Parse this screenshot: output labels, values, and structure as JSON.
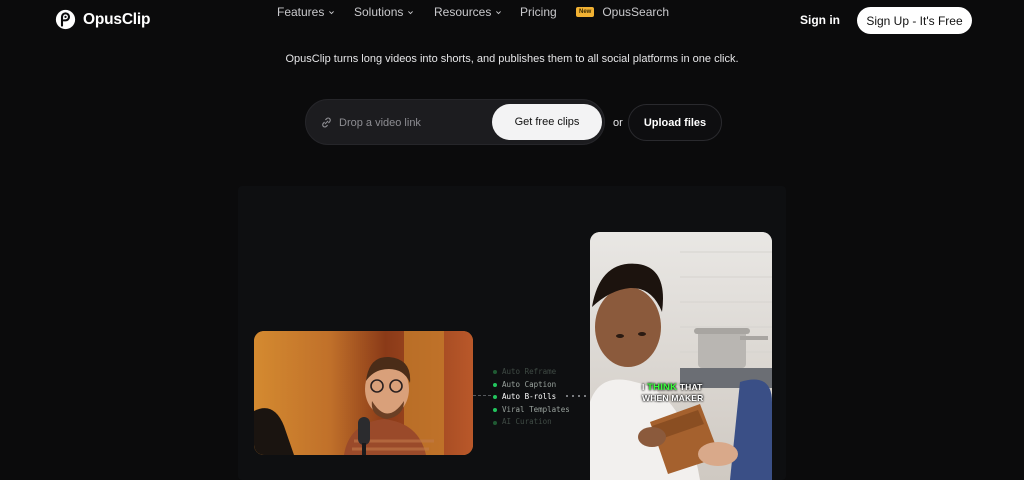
{
  "brand": {
    "name": "OpusClip"
  },
  "nav": {
    "features": "Features",
    "solutions": "Solutions",
    "resources": "Resources",
    "pricing": "Pricing",
    "new_badge": "New",
    "opussearch": "OpusSearch",
    "signin": "Sign in",
    "signup": "Sign Up - It's Free"
  },
  "hero": {
    "tagline": "OpusClip turns long videos into shorts, and publishes them to all social platforms in one click.",
    "input_placeholder": "Drop a video link",
    "get_clips": "Get free clips",
    "or": "or",
    "upload": "Upload files"
  },
  "demo": {
    "features": [
      "Auto Reframe",
      "Auto Caption",
      "Auto B-rolls",
      "Viral Templates",
      "AI Curation"
    ],
    "caption_prefix": "I",
    "caption_highlight": "THINK",
    "caption_rest": "THAT",
    "caption_line2": "WHEN MAKER"
  },
  "colors": {
    "accent_green": "#39ff3e",
    "background": "#0b0b0c",
    "badge": "#f2b233"
  }
}
